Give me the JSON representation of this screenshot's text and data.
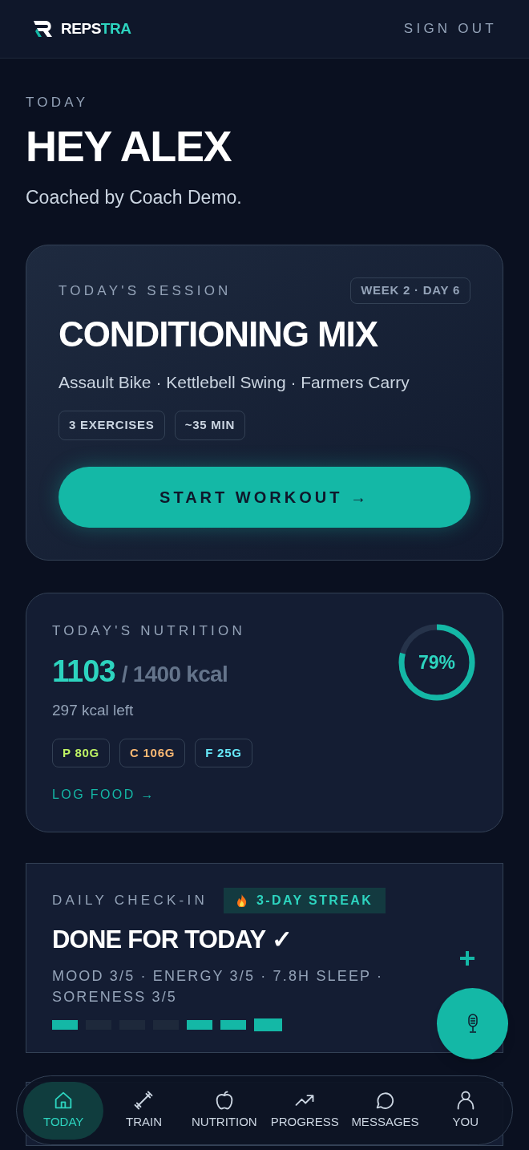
{
  "header": {
    "logo_text_a": "REPS",
    "logo_text_b": "TRA",
    "sign_out": "SIGN OUT"
  },
  "greeting": {
    "eyebrow": "TODAY",
    "title": "HEY ALEX",
    "subtitle": "Coached by Coach Demo."
  },
  "session": {
    "label": "TODAY'S SESSION",
    "badge": "WEEK 2 · DAY 6",
    "title": "CONDITIONING MIX",
    "exercises": "Assault Bike · Kettlebell Swing · Farmers Carry",
    "tags": [
      "3 EXERCISES",
      "~35 MIN"
    ],
    "button": "START WORKOUT →"
  },
  "nutrition": {
    "label": "TODAY'S NUTRITION",
    "eaten": "1103",
    "target": "/ 1400 kcal",
    "left": "297 kcal left",
    "percent": "79%",
    "level": 0.79,
    "macros": [
      {
        "text": "P 80G",
        "color": "#bef264"
      },
      {
        "text": "C 106G",
        "color": "#fdba74"
      },
      {
        "text": "F 25G",
        "color": "#67e8f9"
      }
    ],
    "link": "LOG FOOD →"
  },
  "checkin": {
    "label": "DAILY CHECK-IN",
    "streak": "3-DAY STREAK",
    "title": "DONE FOR TODAY ✓",
    "summary": "MOOD 3/5 · ENERGY 3/5 · 7.8H SLEEP · SORENESS 3/5",
    "days": [
      {
        "done": true,
        "selected": false
      },
      {
        "done": false,
        "selected": false
      },
      {
        "done": false,
        "selected": false
      },
      {
        "done": false,
        "selected": false
      },
      {
        "done": true,
        "selected": false
      },
      {
        "done": true,
        "selected": false
      },
      {
        "done": true,
        "selected": true
      }
    ]
  },
  "nav": [
    {
      "label": "TODAY",
      "kind": "home",
      "selected": true
    },
    {
      "label": "TRAIN",
      "kind": "dumbbell",
      "selected": false
    },
    {
      "label": "NUTRITION",
      "kind": "apple",
      "selected": false
    },
    {
      "label": "PROGRESS",
      "kind": "trend",
      "selected": false
    },
    {
      "label": "MESSAGES",
      "kind": "chat",
      "selected": false
    },
    {
      "label": "YOU",
      "kind": "person",
      "selected": false
    }
  ]
}
